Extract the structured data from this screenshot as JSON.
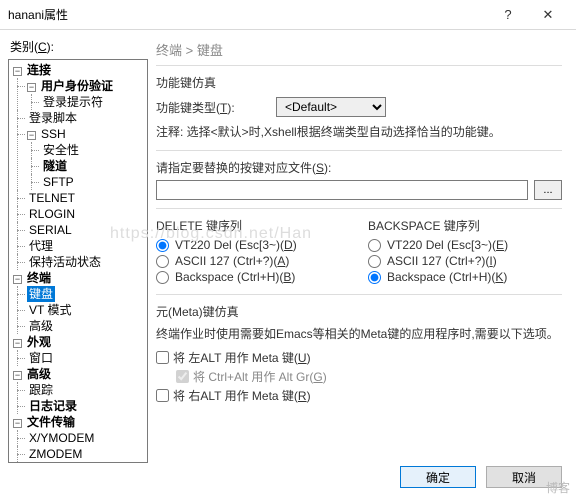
{
  "window": {
    "title": "hanani属性",
    "help": "?",
    "close": "✕"
  },
  "left_label": "类别(C):",
  "tree": {
    "n0": "连接",
    "n0_0": "用户身份验证",
    "n0_0_0": "登录提示符",
    "n0_1": "登录脚本",
    "n0_2": "SSH",
    "n0_2_0": "安全性",
    "n0_2_1": "隧道",
    "n0_2_2": "SFTP",
    "n0_3": "TELNET",
    "n0_4": "RLOGIN",
    "n0_5": "SERIAL",
    "n0_6": "代理",
    "n0_7": "保持活动状态",
    "n1": "终端",
    "n1_0": "键盘",
    "n1_1": "VT 模式",
    "n1_2": "高级",
    "n2": "外观",
    "n2_0": "窗口",
    "n3": "高级",
    "n3_0": "跟踪",
    "n3_1": "日志记录",
    "n4": "文件传输",
    "n4_0": "X/YMODEM",
    "n4_1": "ZMODEM"
  },
  "breadcrumb": "终端 > 键盘",
  "sec1_title": "功能键仿真",
  "type_label": "功能键类型(T):",
  "type_value": "<Default>",
  "type_note": "注释: 选择<默认>时,Xshell根据终端类型自动选择恰当的功能键。",
  "file_label": "请指定要替换的按键对应文件(S):",
  "browse": "...",
  "del_title": "DELETE 键序列",
  "bsp_title": "BACKSPACE 键序列",
  "opt_vt": "VT220 Del (Esc[3~)",
  "opt_ascii": "ASCII 127 (Ctrl+?)",
  "opt_bksp": "Backspace (Ctrl+H)",
  "hk": {
    "d1": "(D)",
    "d2": "(A)",
    "d3": "(B)",
    "b1": "(E)",
    "b2": "(I)",
    "b3": "(K)",
    "u": "(U)",
    "g": "(G)",
    "r": "(R)"
  },
  "meta_title": "元(Meta)键仿真",
  "meta_note": "终端作业时使用需要如Emacs等相关的Meta键的应用程序时,需要以下选项。",
  "meta_left": "将 左ALT 用作 Meta 键",
  "meta_ctrl": "将 Ctrl+Alt 用作 Alt Gr",
  "meta_right": "将 右ALT 用作 Meta 键",
  "ok": "确定",
  "cancel": "取消",
  "watermark": "https://blog.csdn.net/Han",
  "wm2": "博客"
}
